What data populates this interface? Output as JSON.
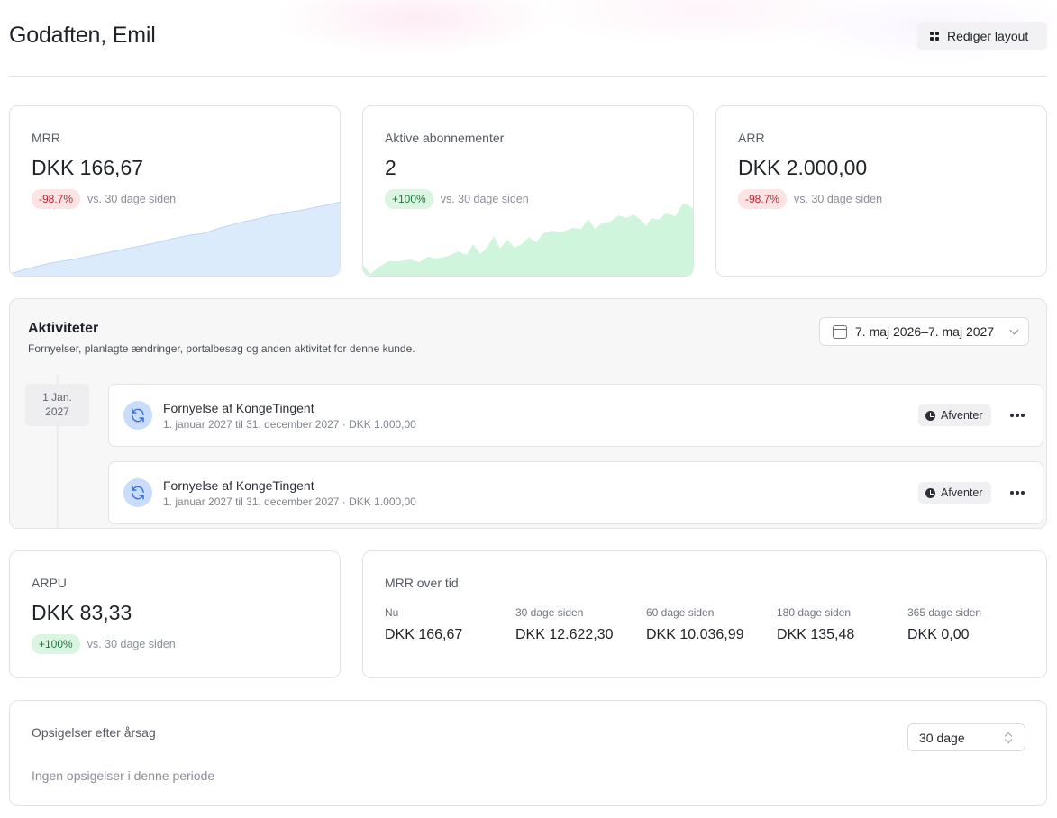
{
  "header": {
    "greeting": "Godaften, Emil",
    "edit_layout_label": "Rediger layout"
  },
  "metrics": [
    {
      "label": "MRR",
      "value": "DKK 166,67",
      "delta": "-98.7%",
      "delta_trend": "negative",
      "comparison": "vs. 30 dage siden",
      "sparkline_color": "#dcebfb"
    },
    {
      "label": "Aktive abonnementer",
      "value": "2",
      "delta": "+100%",
      "delta_trend": "positive",
      "comparison": "vs. 30 dage siden",
      "sparkline_color": "#cff5dd"
    },
    {
      "label": "ARR",
      "value": "DKK 2.000,00",
      "delta": "-98.7%",
      "delta_trend": "negative",
      "comparison": "vs. 30 dage siden"
    }
  ],
  "activities": {
    "title": "Aktiviteter",
    "subtitle": "Fornyelser, planlagte ændringer, portalbesøg og anden aktivitet for denne kunde.",
    "date_range": "7. maj 2026–7. maj 2027",
    "date_group": {
      "day": "1 Jan.",
      "year": "2027"
    },
    "events": [
      {
        "title": "Fornyelse af KongeTingent",
        "subtitle": "1. januar 2027 til 31. december 2027 · DKK 1.000,00",
        "status": "Afventer",
        "icon": "refresh-icon"
      },
      {
        "title": "Fornyelse af KongeTingent",
        "subtitle": "1. januar 2027 til 31. december 2027 · DKK 1.000,00",
        "status": "Afventer",
        "icon": "refresh-icon"
      }
    ]
  },
  "arpu": {
    "label": "ARPU",
    "value": "DKK 83,33",
    "delta": "+100%",
    "delta_trend": "positive",
    "comparison": "vs. 30 dage siden"
  },
  "mrr_over_time": {
    "title": "MRR over tid",
    "columns": [
      {
        "label": "Nu",
        "value": "DKK 166,67"
      },
      {
        "label": "30 dage siden",
        "value": "DKK 12.622,30"
      },
      {
        "label": "60 dage siden",
        "value": "DKK 10.036,99"
      },
      {
        "label": "180 dage siden",
        "value": "DKK 135,48"
      },
      {
        "label": "365 dage siden",
        "value": "DKK 0,00"
      }
    ]
  },
  "cancellations": {
    "title": "Opsigelser efter årsag",
    "period_selected": "30 dage",
    "empty_text": "Ingen opsigelser i denne periode"
  },
  "colors": {
    "negative_bg": "#fde4e4",
    "negative_text": "#c0262d",
    "positive_bg": "#dcf5e3",
    "positive_text": "#1c7a3c"
  }
}
